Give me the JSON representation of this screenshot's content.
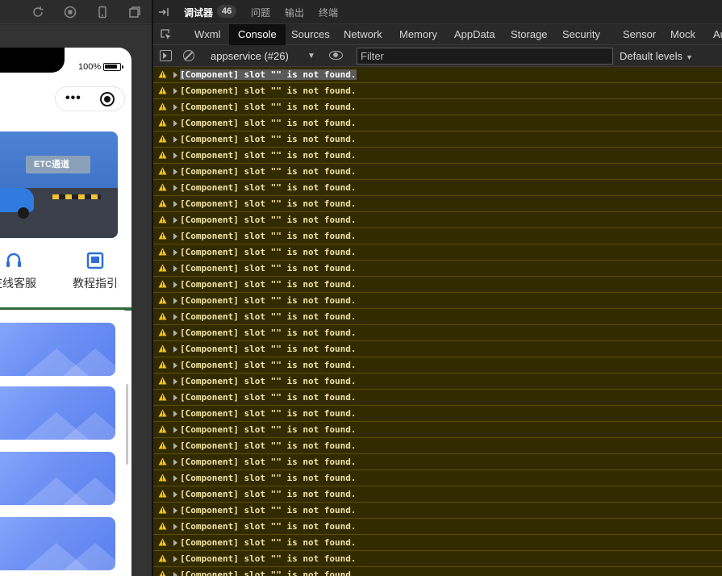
{
  "simulator": {
    "battery_text": "100%",
    "nav_items": [
      {
        "label": "在线客服",
        "icon": "headset-icon"
      },
      {
        "label": "教程指引",
        "icon": "book-icon"
      }
    ],
    "banner_text": "ETC通道"
  },
  "devtools": {
    "top_tabs": {
      "debugger": "调试器",
      "debugger_count": "46",
      "issues": "问题",
      "output": "输出",
      "terminal": "终端"
    },
    "panel_tabs": [
      "Wxml",
      "Console",
      "Sources",
      "Network",
      "Memory",
      "AppData",
      "Storage",
      "Security",
      "Sensor",
      "Mock",
      "Audits"
    ],
    "active_panel": "Console",
    "console_toolbar": {
      "context": "appservice (#26)",
      "filter_placeholder": "Filter",
      "levels": "Default levels"
    },
    "messages": [
      "[Component] slot \"\" is not found.",
      "[Component] slot \"\" is not found.",
      "[Component] slot \"\" is not found.",
      "[Component] slot \"\" is not found.",
      "[Component] slot \"\" is not found.",
      "[Component] slot \"\" is not found.",
      "[Component] slot \"\" is not found.",
      "[Component] slot \"\" is not found.",
      "[Component] slot \"\" is not found.",
      "[Component] slot \"\" is not found.",
      "[Component] slot \"\" is not found.",
      "[Component] slot \"\" is not found.",
      "[Component] slot \"\" is not found.",
      "[Component] slot \"\" is not found.",
      "[Component] slot \"\" is not found.",
      "[Component] slot \"\" is not found.",
      "[Component] slot \"\" is not found.",
      "[Component] slot \"\" is not found.",
      "[Component] slot \"\" is not found.",
      "[Component] slot \"\" is not found.",
      "[Component] slot \"\" is not found.",
      "[Component] slot \"\" is not found.",
      "[Component] slot \"\" is not found.",
      "[Component] slot \"\" is not found.",
      "[Component] slot \"\" is not found.",
      "[Component] slot \"\" is not found.",
      "[Component] slot \"\" is not found.",
      "[Component] slot \"\" is not found.",
      "[Component] slot \"\" is not found.",
      "[Component] slot \"\" is not found.",
      "[Component] slot \"\" is not found.",
      "[Component] slot \"\" is not found."
    ],
    "message_level": "warning"
  },
  "colors": {
    "warning_bg": "#332b00",
    "warning_border": "#5c5000",
    "warning_text": "#f0e2a8",
    "warning_icon": "#f5c518",
    "active_tab_bg": "#0f0f0f",
    "sheet_card": "#6f92f5"
  }
}
